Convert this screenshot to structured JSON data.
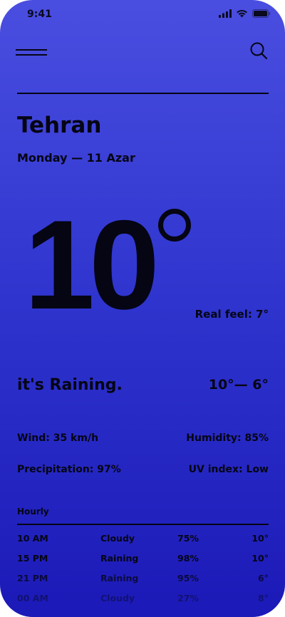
{
  "status_bar": {
    "time": "9:41",
    "icons": [
      "cellular-signal-icon",
      "wifi-icon",
      "battery-icon"
    ]
  },
  "nav": {
    "menu_icon": "hamburger-menu-icon",
    "search_icon": "search-icon"
  },
  "location": {
    "city": "Tehran",
    "date": "Monday — 11 Azar"
  },
  "current": {
    "temperature": "10",
    "real_feel": "Real feel: 7°",
    "condition": "it's Raining.",
    "range": "10°— 6°"
  },
  "details": {
    "wind": "Wind: 35 km/h",
    "humidity": "Humidity: 85%",
    "precipitation": "Precipitation: 97%",
    "uv_index": "UV index: Low"
  },
  "hourly": {
    "title": "Hourly",
    "rows": [
      {
        "time": "10 AM",
        "condition": "Cloudy",
        "humidity": "75%",
        "temp": "10°"
      },
      {
        "time": "15 PM",
        "condition": "Raining",
        "humidity": "98%",
        "temp": "10°"
      },
      {
        "time": "21 PM",
        "condition": "Raining",
        "humidity": "95%",
        "temp": "6°"
      },
      {
        "time": "00 AM",
        "condition": "Cloudy",
        "humidity": "27%",
        "temp": "8°"
      }
    ]
  },
  "colors": {
    "gradient_top": "#4a4ee0",
    "gradient_bottom": "#1c1ab8",
    "text": "#050514"
  }
}
